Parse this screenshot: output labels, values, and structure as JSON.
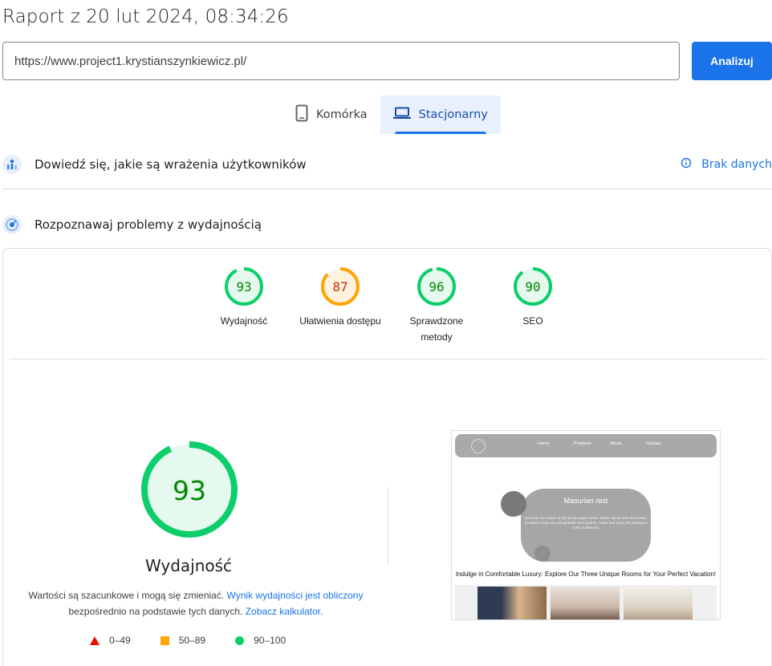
{
  "report": {
    "title": "Raport z 20 lut 2024, 08:34:26"
  },
  "url_bar": {
    "value": "https://www.project1.krystianszynkiewicz.pl/",
    "analyze_label": "Analizuj"
  },
  "device_tabs": [
    {
      "label": "Komórka",
      "icon": "smartphone-icon",
      "active": false
    },
    {
      "label": "Stacjonarny",
      "icon": "laptop-icon",
      "active": true
    }
  ],
  "field_data": {
    "label": "Dowiedź się, jakie są wrażenia użytkowników",
    "status": "Brak danych"
  },
  "lab_data": {
    "label": "Rozpoznawaj problemy z wydajnością"
  },
  "categories": [
    {
      "score": 93,
      "label": "Wydajność",
      "color": "#0cce6b",
      "text_color": "#008800",
      "bg": "#e6f9ee"
    },
    {
      "score": 87,
      "label": "Ułatwienia dostępu",
      "color": "#ffa400",
      "text_color": "#c33300",
      "bg": "#fff3e0"
    },
    {
      "score": 96,
      "label": "Sprawdzone metody",
      "color": "#0cce6b",
      "text_color": "#008800",
      "bg": "#e6f9ee"
    },
    {
      "score": 90,
      "label": "SEO",
      "color": "#0cce6b",
      "text_color": "#008800",
      "bg": "#e6f9ee"
    }
  ],
  "performance": {
    "score": 93,
    "title": "Wydajność",
    "note_text1": "Wartości są szacunkowe i mogą się zmieniać.",
    "note_link1": "Wynik wydajności jest obliczony",
    "note_text2": "bezpośrednio na podstawie tych danych.",
    "note_link2": "Zobacz kalkulator",
    "note_end": "."
  },
  "legend": [
    {
      "range": "0–49",
      "shape": "triangle",
      "color": "#eb0f00"
    },
    {
      "range": "50–89",
      "shape": "square",
      "color": "#ffa400"
    },
    {
      "range": "90–100",
      "shape": "circle",
      "color": "#0cce6b"
    }
  ],
  "screenshot": {
    "nav": [
      "Home",
      "Products",
      "About",
      "Contact"
    ],
    "hero_title": "Masurian rest",
    "hero_text": "Discover the charm of this picturesque corner, where silence and the beauty of nature create an unforgettable atmosphere. Relax and enjoy the pleasures of life in Masuria.",
    "tagline": "Indulge in Comfortable Luxury: Explore Our Three Unique Rooms for Your Perfect Vacation!"
  }
}
